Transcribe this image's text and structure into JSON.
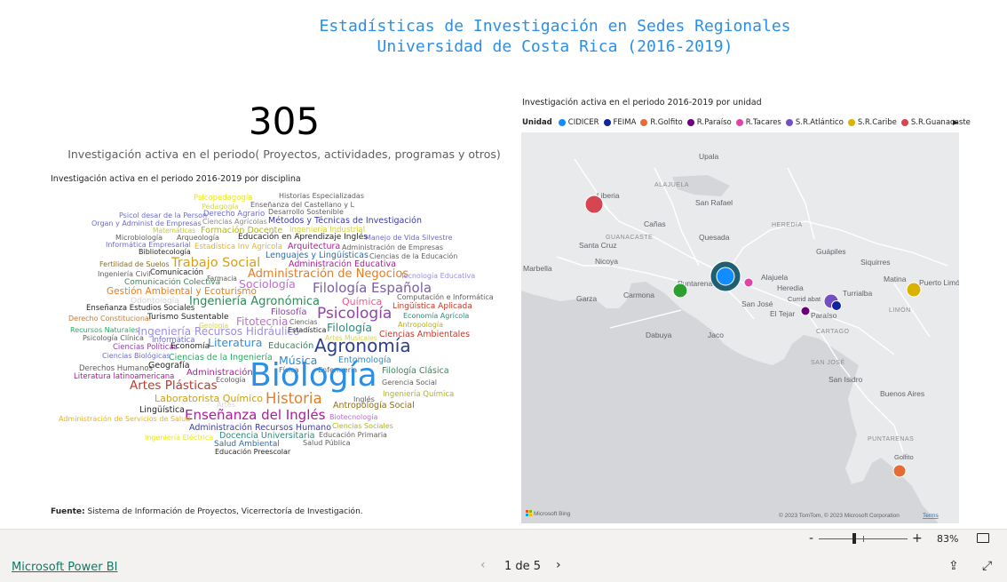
{
  "header": {
    "title_line1": "Estadísticas de Investigación en Sedes Regionales",
    "title_line2": "Universidad de Costa Rica (2016-2019)"
  },
  "kpi": {
    "value": "305",
    "label": "Investigación activa en el periodo( Proyectos, actividades, programas y otros)"
  },
  "wordcloud": {
    "title": "Investigación activa en el periodo 2016-2019 por disciplina",
    "words": [
      {
        "text": "Psicopedagogía",
        "color": "#e8e81a"
      },
      {
        "text": "Historias Especializadas",
        "color": "#605e5c"
      },
      {
        "text": "Pedagogía",
        "color": "#d4d454"
      },
      {
        "text": "Enseñanza del Castellano y L",
        "color": "#605e5c"
      },
      {
        "text": "Psicol desar de la Person",
        "color": "#6c6ccf"
      },
      {
        "text": "Derecho Agrario",
        "color": "#6c6ccf"
      },
      {
        "text": "Desarrollo Sostenible",
        "color": "#605e5c"
      },
      {
        "text": "Organ y Administ de Empresas",
        "color": "#6c6ccf"
      },
      {
        "text": "Ciencias Agrícolas",
        "color": "#8a8886"
      },
      {
        "text": "Métodos y Técnicas de Investigación",
        "color": "#3b3ba8"
      },
      {
        "text": "Matemáticas",
        "color": "#c8c83a"
      },
      {
        "text": "Formación Docente",
        "color": "#b3b31a"
      },
      {
        "text": "Ingeniería Industrial",
        "color": "#d4d43a"
      },
      {
        "text": "Microbiología",
        "color": "#605e5c"
      },
      {
        "text": "Arqueología",
        "color": "#605e5c"
      },
      {
        "text": "Educación en Aprendizaje Inglés",
        "color": "#252423"
      },
      {
        "text": "Manejo de Vida Silvestre",
        "color": "#6c6ccf"
      },
      {
        "text": "Informática Empresarial",
        "color": "#6c6ccf"
      },
      {
        "text": "Estadística Inv Agrícola",
        "color": "#e6b422"
      },
      {
        "text": "Arquitectura",
        "color": "#b5179e"
      },
      {
        "text": "Administración de Empresas",
        "color": "#605e5c"
      },
      {
        "text": "Bibliotecología",
        "color": "#252423"
      },
      {
        "text": "Lenguajes y Lingüísticas",
        "color": "#2b6cb0"
      },
      {
        "text": "Ciencias de la Educación",
        "color": "#605e5c"
      },
      {
        "text": "Fertilidad de Suelos",
        "color": "#8a6d1a"
      },
      {
        "text": "Trabajo Social",
        "color": "#d4a017"
      },
      {
        "text": "Administración Educativa",
        "color": "#b5179e"
      },
      {
        "text": "Ingeniería Civil",
        "color": "#605e5c"
      },
      {
        "text": "Comunicación",
        "color": "#252423"
      },
      {
        "text": "Administración de Negocios",
        "color": "#e67e22"
      },
      {
        "text": "Farmacia",
        "color": "#605e5c"
      },
      {
        "text": "Tecnología Educativa",
        "color": "#9b8fe0"
      },
      {
        "text": "Comunicación Colectiva",
        "color": "#2e8b57"
      },
      {
        "text": "Sociología",
        "color": "#c06bd6"
      },
      {
        "text": "Filología Española",
        "color": "#7b5ea7"
      },
      {
        "text": "Gestión Ambiental y Ecoturismo",
        "color": "#e67e22"
      },
      {
        "text": "Odontología",
        "color": "#d4d4d4"
      },
      {
        "text": "Computación e Informática",
        "color": "#605e5c"
      },
      {
        "text": "Enseñanza Estudios Sociales",
        "color": "#252423"
      },
      {
        "text": "Ingeniería Agronómica",
        "color": "#2e8b57"
      },
      {
        "text": "Química",
        "color": "#e65c8c"
      },
      {
        "text": "Lingüística Aplicada",
        "color": "#c0392b"
      },
      {
        "text": "Filosofía",
        "color": "#8e44ad"
      },
      {
        "text": "Psicología",
        "color": "#8e44ad"
      },
      {
        "text": "Economía Agrícola",
        "color": "#2e8b7a"
      },
      {
        "text": "Derecho Constitucional",
        "color": "#c07a3a"
      },
      {
        "text": "Turismo Sustentable",
        "color": "#252423"
      },
      {
        "text": "Fitotecnia",
        "color": "#c06bd6"
      },
      {
        "text": "Ciencias",
        "color": "#605e5c"
      },
      {
        "text": "Recursos Naturales",
        "color": "#27ae60"
      },
      {
        "text": "Geología",
        "color": "#d4d454"
      },
      {
        "text": "Antropología",
        "color": "#b3b31a"
      },
      {
        "text": "Ingeniería Recursos Hidráulico",
        "color": "#9b8fe0"
      },
      {
        "text": "Filología",
        "color": "#2e8b7a"
      },
      {
        "text": "Psicología Clínica",
        "color": "#605e5c"
      },
      {
        "text": "Estadística",
        "color": "#252423"
      },
      {
        "text": "Ciencias Ambientales",
        "color": "#c0392b"
      },
      {
        "text": "Informática",
        "color": "#6c6ccf"
      },
      {
        "text": "Literatura",
        "color": "#2b8fe8"
      },
      {
        "text": "Agronomía",
        "color": "#2c3e8f"
      },
      {
        "text": "Artes Musicales",
        "color": "#d4d454"
      },
      {
        "text": "Ciencias Políticas",
        "color": "#8e44ad"
      },
      {
        "text": "Economía",
        "color": "#252423"
      },
      {
        "text": "Educación",
        "color": "#2e8b57"
      },
      {
        "text": "Ciencias Biológicas",
        "color": "#6c6ccf"
      },
      {
        "text": "Ciencias de la Ingeniería",
        "color": "#27ae60"
      },
      {
        "text": "Música",
        "color": "#2e8bcf"
      },
      {
        "text": "Entomología",
        "color": "#2e8bcf"
      },
      {
        "text": "Derechos Humanos",
        "color": "#605e5c"
      },
      {
        "text": "Geografía",
        "color": "#252423"
      },
      {
        "text": "Física",
        "color": "#605e5c"
      },
      {
        "text": "Enfermería",
        "color": "#605e5c"
      },
      {
        "text": "Literatura latinoamericana",
        "color": "#b5179e"
      },
      {
        "text": "Administración",
        "color": "#b5179e"
      },
      {
        "text": "Filología Clásica",
        "color": "#2e8b57"
      },
      {
        "text": "Ecología",
        "color": "#605e5c"
      },
      {
        "text": "Biología",
        "color": "#2b8fe8"
      },
      {
        "text": "Gerencia Social",
        "color": "#605e5c"
      },
      {
        "text": "Artes Plásticas",
        "color": "#c0392b"
      },
      {
        "text": "Ingeniería Química",
        "color": "#b3b31a"
      },
      {
        "text": "Laboratorista Químico",
        "color": "#c8a01a"
      },
      {
        "text": "Historia",
        "color": "#e67e22"
      },
      {
        "text": "Inglés",
        "color": "#605e5c"
      },
      {
        "text": "Artes",
        "color": "#d4d4d4"
      },
      {
        "text": "Antropología Social",
        "color": "#8a6d1a"
      },
      {
        "text": "Lingüística",
        "color": "#252423"
      },
      {
        "text": "Enseñanza del Inglés",
        "color": "#b5179e"
      },
      {
        "text": "Biotecnología",
        "color": "#c06bd6"
      },
      {
        "text": "Administración de Servicios de Salud",
        "color": "#e6b422"
      },
      {
        "text": "Ciencias Sociales",
        "color": "#b3b31a"
      },
      {
        "text": "Administración Recursos Humano",
        "color": "#3b3ba8"
      },
      {
        "text": "Educación Primaria",
        "color": "#605e5c"
      },
      {
        "text": "Ingeniería Eléctrica",
        "color": "#e8e81a"
      },
      {
        "text": "Docencia Universitaria",
        "color": "#2e8b7a"
      },
      {
        "text": "Salud Ambiental",
        "color": "#2b6cb0"
      },
      {
        "text": "Salud Pública",
        "color": "#605e5c"
      },
      {
        "text": "Educación Preescolar",
        "color": "#252423"
      }
    ]
  },
  "source": {
    "label": "Fuente:",
    "text": "Sistema de Información de Proyectos, Vicerrectoría de Investigación."
  },
  "map_visual": {
    "title": "Investigación activa en el periodo 2016-2019 por unidad",
    "legend_title": "Unidad",
    "legend": [
      {
        "name": "CIDICER",
        "color": "#118dff"
      },
      {
        "name": "FEIMA",
        "color": "#12239e"
      },
      {
        "name": "R.Golfito",
        "color": "#e66c37"
      },
      {
        "name": "R.Paraíso",
        "color": "#6b007b"
      },
      {
        "name": "R.Tacares",
        "color": "#e044a7"
      },
      {
        "name": "S.R.Atlántico",
        "color": "#744ec2"
      },
      {
        "name": "S.R.Caribe",
        "color": "#d9b300"
      },
      {
        "name": "S.R.Guanacaste",
        "color": "#d64550"
      }
    ],
    "legend_more_icon": "chevron-right-icon",
    "places": [
      "Liberia",
      "ALAJUELA",
      "San Rafael",
      "Cañas",
      "GUANACASTE",
      "Santa Cruz",
      "Quesada",
      "HEREDIA",
      "Upala",
      "Guápiles",
      "Siquirres",
      "Nicoya",
      "Marbella",
      "Puntarenas",
      "Carmona",
      "Garza",
      "Alajuela",
      "Heredia",
      "San José",
      "Turrialba",
      "Matina",
      "Puerto Limón",
      "LIMÓN",
      "El Tejar",
      "Paraíso",
      "Currid abat",
      "CARTAGO",
      "SAN JOSÉ",
      "Dabuya",
      "Jaco",
      "San Isidro",
      "Buenos Aires",
      "PUNTARENAS",
      "Golfito"
    ],
    "bubbles": [
      {
        "unit": "S.R.Guanacaste",
        "color": "#d64550"
      },
      {
        "unit": "CIDICER",
        "color": "#118dff"
      },
      {
        "unit": "R.Tacares",
        "color": "#e044a7"
      },
      {
        "unit": "S.R.Atlántico",
        "color": "#744ec2"
      },
      {
        "unit": "FEIMA",
        "color": "#12239e"
      },
      {
        "unit": "R.Paraíso",
        "color": "#6b007b"
      },
      {
        "unit": "S.R.Caribe",
        "color": "#d9b300"
      },
      {
        "unit": "R.Golfito",
        "color": "#e66c37"
      },
      {
        "unit": "Puntarenas",
        "color": "#2ca02c"
      }
    ],
    "attribution": "© 2023 TomTom, © 2023 Microsoft Corporation",
    "terms": "Terms",
    "bing_logo": "Microsoft Bing"
  },
  "zoom": {
    "minus": "-",
    "plus": "+",
    "value": "83%",
    "fit_icon": "fit-to-page-icon"
  },
  "footer": {
    "brand_link": "Microsoft Power BI",
    "page_indicator": "1 de 5",
    "prev_icon": "chevron-left-icon",
    "next_icon": "chevron-right-icon",
    "share_icon": "share-icon",
    "fullscreen_icon": "expand-icon"
  }
}
